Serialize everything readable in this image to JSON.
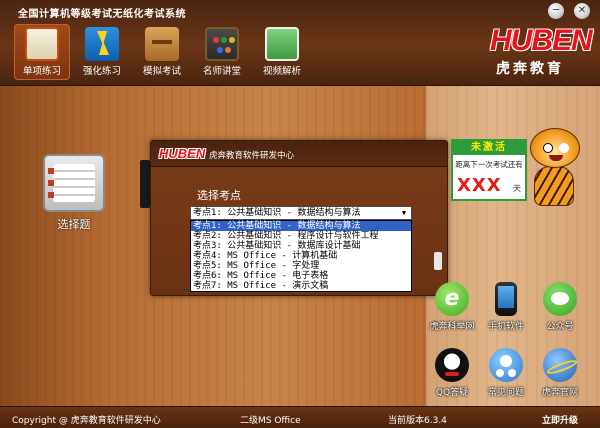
{
  "window": {
    "title": "全国计算机等级考试无纸化考试系统",
    "minimize_glyph": "─",
    "close_glyph": "✕"
  },
  "toolbar": {
    "items": [
      {
        "label": "单项练习",
        "icon": "notebook-icon",
        "active": true
      },
      {
        "label": "强化练习",
        "icon": "lightning-icon",
        "active": false
      },
      {
        "label": "模拟考试",
        "icon": "briefcase-icon",
        "active": false
      },
      {
        "label": "名师讲堂",
        "icon": "blackboard-icon",
        "active": false
      },
      {
        "label": "视频解析",
        "icon": "video-clipboard-icon",
        "active": false
      }
    ]
  },
  "brand": {
    "logo_text": "HUBEN",
    "logo_subtitle": "虎奔教育",
    "logo_color": "#e8121a"
  },
  "left_tile": {
    "label": "选择题",
    "icon": "checklist-icon"
  },
  "dialog": {
    "logo_text": "HUBEN",
    "title": "虎奔教育软件研发中心",
    "select_label": "选择考点",
    "selected_value": "考点1: 公共基础知识 - 数据结构与算法",
    "options": [
      "考点1: 公共基础知识 - 数据结构与算法",
      "考点2: 公共基础知识 - 程序设计与软件工程",
      "考点3: 公共基础知识 - 数据库设计基础",
      "考点4: MS Office - 计算机基础",
      "考点5: MS Office - 字处理",
      "考点6: MS Office - 电子表格",
      "考点7: MS Office - 演示文稿"
    ],
    "highlight_color": "#3163c6"
  },
  "activation": {
    "status": "未激活",
    "remain_label": "距离下一次考试还有",
    "days": "XXX",
    "unit": "天",
    "accent": "#2e9b3c"
  },
  "app_icons": [
    {
      "label": "虎奔科举网",
      "icon": "browser-e-icon"
    },
    {
      "label": "手机软件",
      "icon": "smartphone-icon"
    },
    {
      "label": "公众号",
      "icon": "wechat-icon"
    },
    {
      "label": "QQ答疑",
      "icon": "qq-penguin-icon"
    },
    {
      "label": "常见问题",
      "icon": "faq-people-icon"
    },
    {
      "label": "虎奔官网",
      "icon": "globe-icon"
    }
  ],
  "statusbar": {
    "copyright": "Copyright @ 虎奔教育软件研发中心",
    "level": "二级MS Office",
    "version": "当前版本6.3.4",
    "upgrade": "立即升级"
  }
}
